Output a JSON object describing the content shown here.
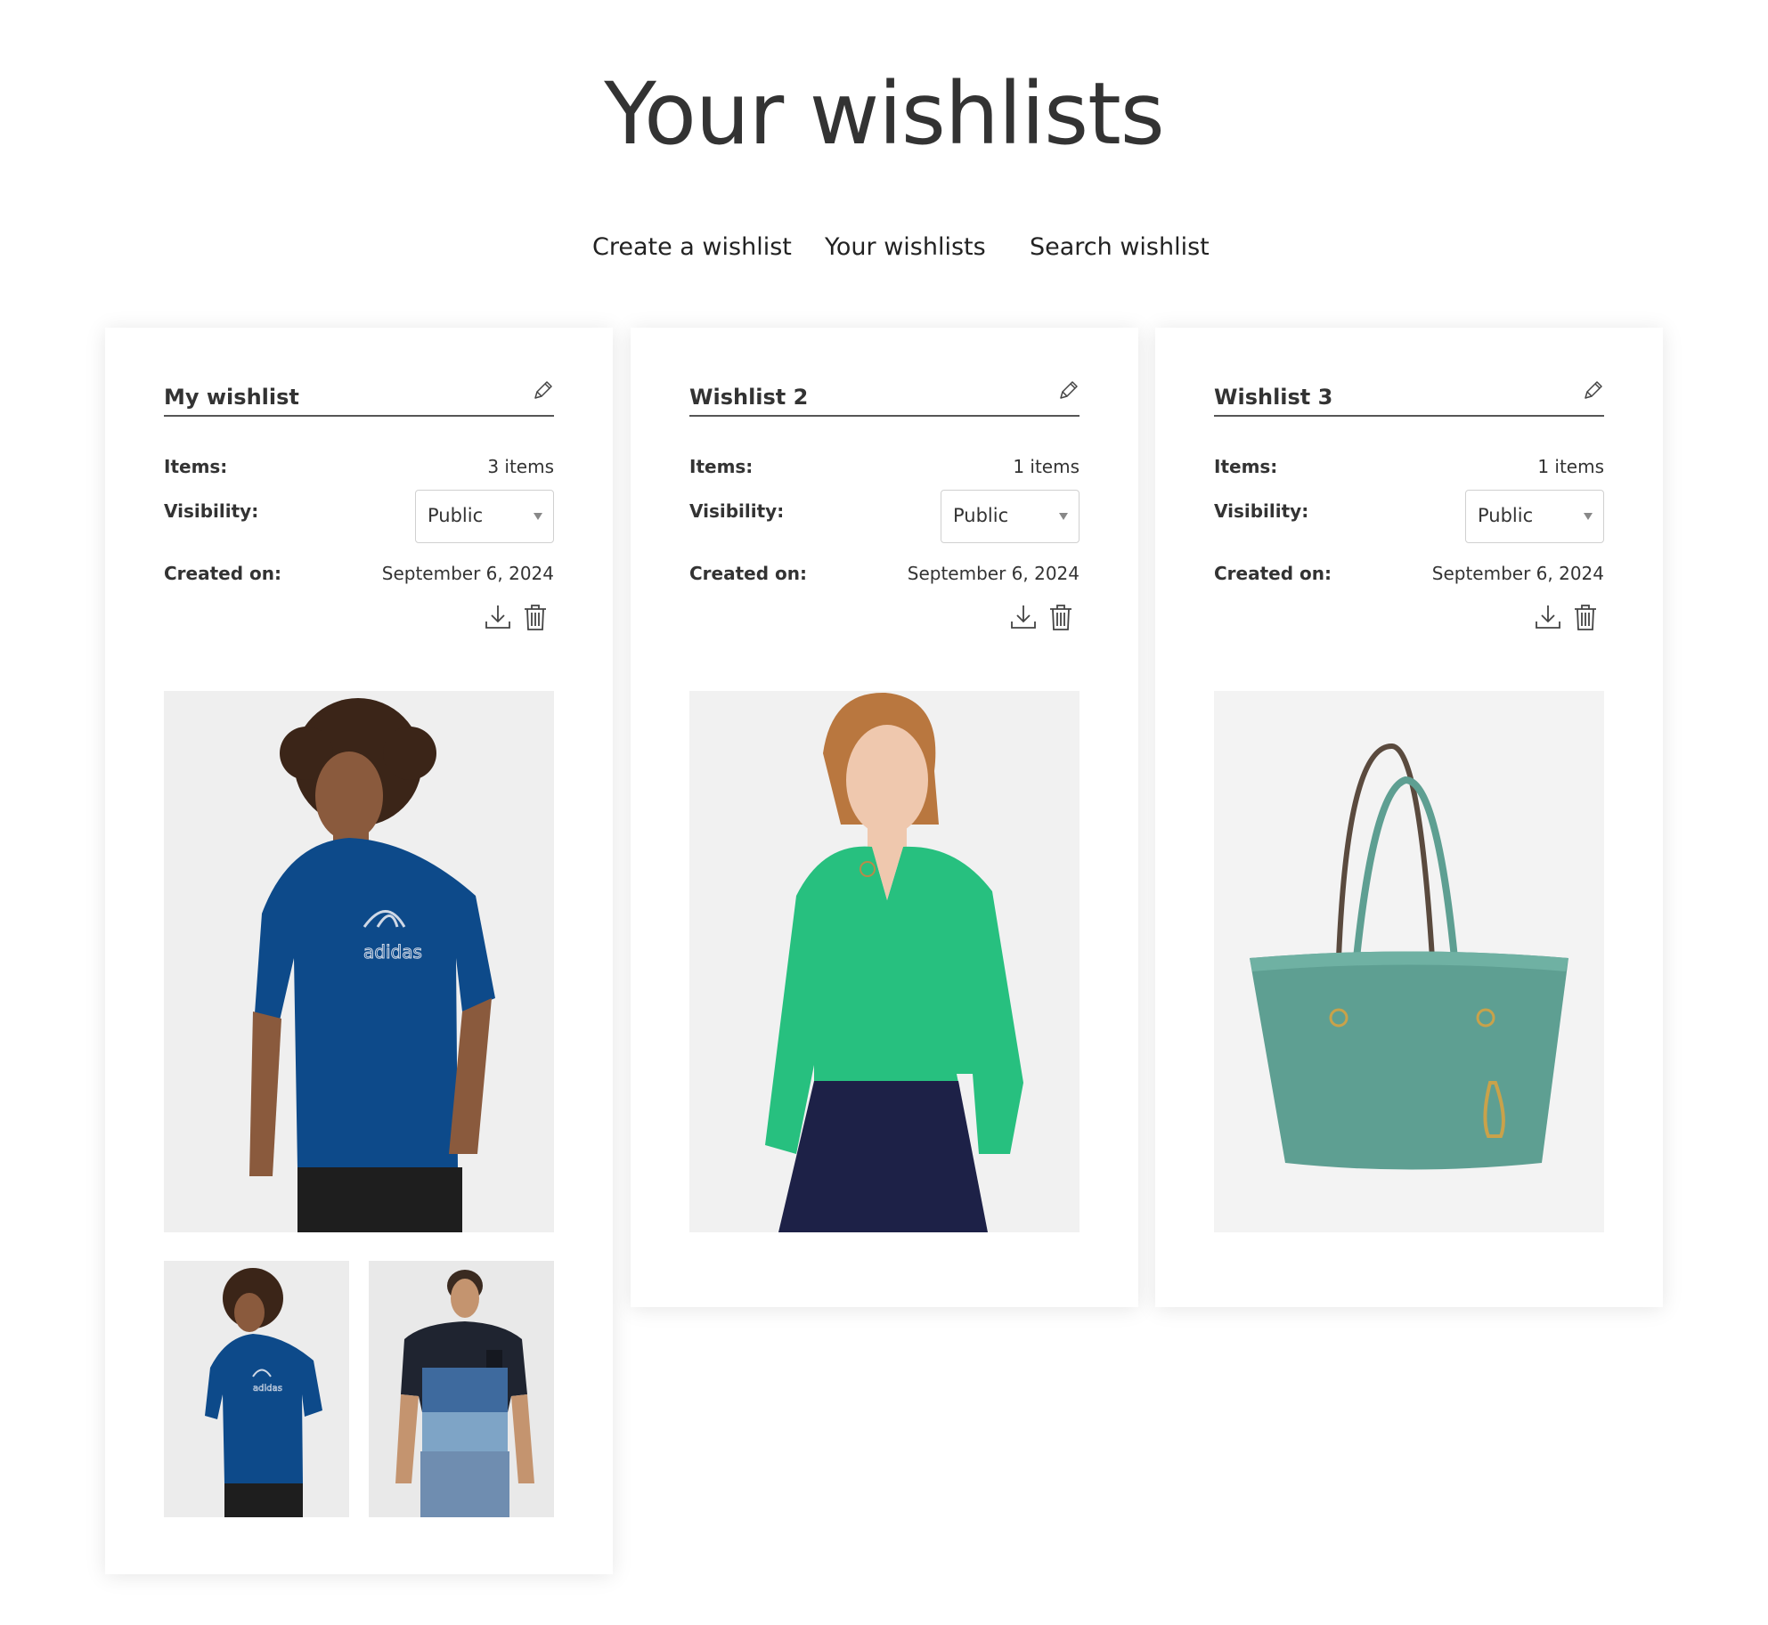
{
  "page": {
    "title": "Your wishlists"
  },
  "nav": {
    "create": "Create a wishlist",
    "yours": "Your wishlists",
    "search": "Search wishlist"
  },
  "labels": {
    "items": "Items:",
    "visibility": "Visibility:",
    "created": "Created on:"
  },
  "icons": {
    "edit": "pencil-icon",
    "download": "download-icon",
    "delete": "trash-icon",
    "select": "caret-down-icon"
  },
  "wishlists": [
    {
      "name": "My wishlist",
      "items": "3 items",
      "visibility": "Public",
      "created": "September 6, 2024",
      "products": [
        {
          "kind": "model in navy adidas t-shirt"
        },
        {
          "kind": "model in navy adidas t-shirt"
        },
        {
          "kind": "model in colour-block t-shirt"
        }
      ]
    },
    {
      "name": "Wishlist 2",
      "items": "1 items",
      "visibility": "Public",
      "created": "September 6, 2024",
      "products": [
        {
          "kind": "model in green blouse"
        }
      ]
    },
    {
      "name": "Wishlist 3",
      "items": "1 items",
      "visibility": "Public",
      "created": "September 6, 2024",
      "products": [
        {
          "kind": "teal leather tote bag"
        }
      ]
    }
  ],
  "colors": {
    "title": "#333333",
    "navy_shirt": "#0d4a8a",
    "green_blouse": "#27c07f",
    "teal_bag": "#5e9f92",
    "image_bg": "#f1f1f1"
  }
}
